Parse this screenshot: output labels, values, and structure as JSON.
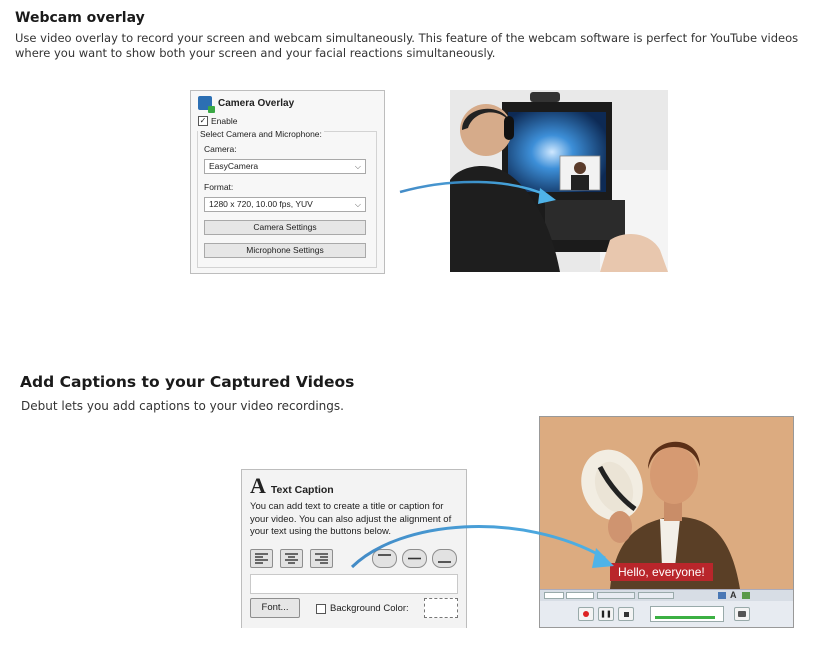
{
  "section1": {
    "title": "Webcam overlay",
    "description_line1": "Use video overlay to record your screen and webcam simultaneously. This feature of the webcam software is perfect for YouTube videos",
    "description_line2": "where you want to show both your screen and your facial reactions simultaneously."
  },
  "camera_overlay": {
    "title": "Camera Overlay",
    "enable_label": "Enable",
    "enable_checked": true,
    "group_label": "Select Camera and Microphone:",
    "camera_label": "Camera:",
    "camera_value": "EasyCamera",
    "format_label": "Format:",
    "format_value": "1280 x 720, 10.00 fps, YUV",
    "camera_settings_button": "Camera Settings",
    "microphone_settings_button": "Microphone Settings"
  },
  "section2": {
    "title": "Add Captions to your Captured Videos",
    "description": "Debut lets you add captions to your video recordings."
  },
  "text_caption": {
    "icon_letter": "A",
    "title": "Text Caption",
    "help_line1": "You can add text to create a title or caption for",
    "help_line2": "your video. You can also adjust the alignment of",
    "help_line3": "your text using the buttons below.",
    "font_button": "Font...",
    "background_color_label": "Background Color:"
  },
  "photo_caption": {
    "text": "Hello, everyone!"
  },
  "colors": {
    "caption_red": "#b9262b",
    "arrow_blue": "#2f7fc1"
  }
}
